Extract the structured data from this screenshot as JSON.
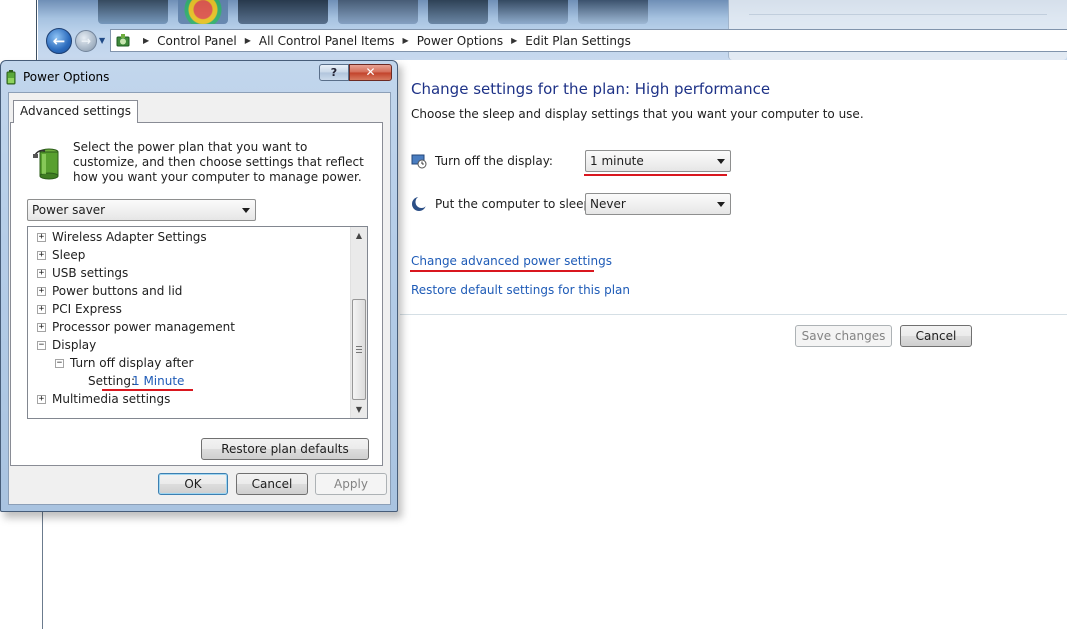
{
  "explorer": {
    "breadcrumb": [
      "Control Panel",
      "All Control Panel Items",
      "Power Options",
      "Edit Plan Settings"
    ],
    "page_title": "Change settings for the plan: High performance",
    "page_subtitle": "Choose the sleep and display settings that you want your computer to use.",
    "display_label": "Turn off the display:",
    "display_value": "1 minute",
    "sleep_label": "Put the computer to sleep:",
    "sleep_value": "Never",
    "advanced_link": "Change advanced power settings",
    "restore_link": "Restore default settings for this plan",
    "save_button": "Save changes",
    "cancel_button": "Cancel"
  },
  "dialog": {
    "title": "Power Options",
    "help_label": "?",
    "close_label": "✕",
    "tab_label": "Advanced settings",
    "intro": "Select the power plan that you want to customize, and then choose settings that reflect how you want your computer to manage power.",
    "plan_value": "Power saver",
    "tree": {
      "wireless": "Wireless Adapter Settings",
      "sleep": "Sleep",
      "usb": "USB settings",
      "power_buttons": "Power buttons and lid",
      "pci": "PCI Express",
      "processor": "Processor power management",
      "display": "Display",
      "turn_off": "Turn off display after",
      "setting_label": "Setting:",
      "setting_value": "1 Minute",
      "multimedia": "Multimedia settings"
    },
    "restore_button": "Restore plan defaults",
    "ok_button": "OK",
    "cancel_button": "Cancel",
    "apply_button": "Apply"
  },
  "colors": {
    "link": "#1e5bb7",
    "title_blue": "#1e3287",
    "highlight_underline": "#d9171f"
  },
  "icons": [
    "back-arrow-icon",
    "forward-arrow-icon",
    "control-panel-icon",
    "display-clock-icon",
    "moon-sleep-icon",
    "battery-plug-icon"
  ]
}
